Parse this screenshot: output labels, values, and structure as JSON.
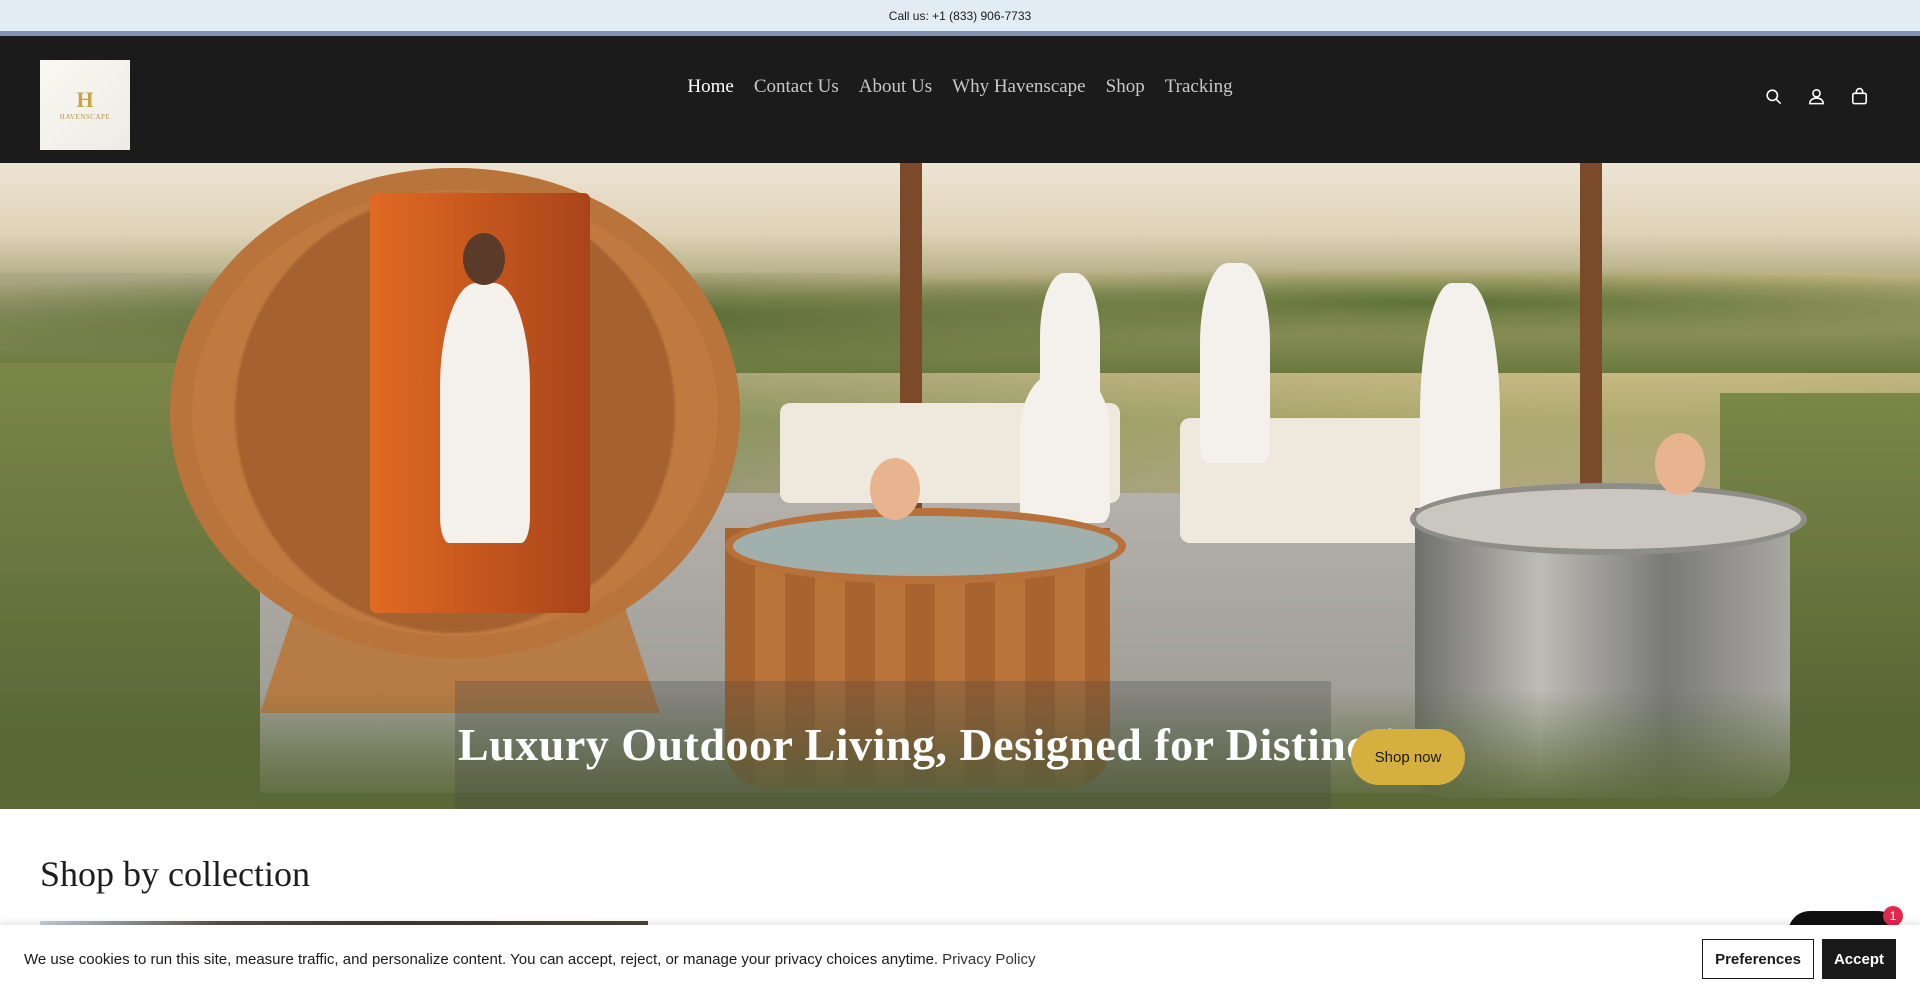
{
  "announcement": {
    "text": "Call us: +1 (833) 906-7733"
  },
  "header": {
    "logo": {
      "mark": "H",
      "text": "HAVENSCAPE"
    },
    "nav": [
      {
        "label": "Home",
        "active": true
      },
      {
        "label": "Contact Us",
        "active": false
      },
      {
        "label": "About Us",
        "active": false
      },
      {
        "label": "Why Havenscape",
        "active": false
      },
      {
        "label": "Shop",
        "active": false
      },
      {
        "label": "Tracking",
        "active": false
      }
    ],
    "icons": [
      "search-icon",
      "account-icon",
      "cart-icon"
    ]
  },
  "hero": {
    "title": "Luxury Outdoor Living, Designed for Distinction",
    "button_label": "Shop now",
    "button_color": "#d6b03e"
  },
  "collections": {
    "title": "Shop by collection"
  },
  "chat": {
    "badge_count": "1"
  },
  "cookie": {
    "text": "We use cookies to run this site, measure traffic, and personalize content. You can accept, reject, or manage your privacy choices anytime.",
    "link_label": "Privacy Policy",
    "preferences_label": "Preferences",
    "accept_label": "Accept"
  }
}
